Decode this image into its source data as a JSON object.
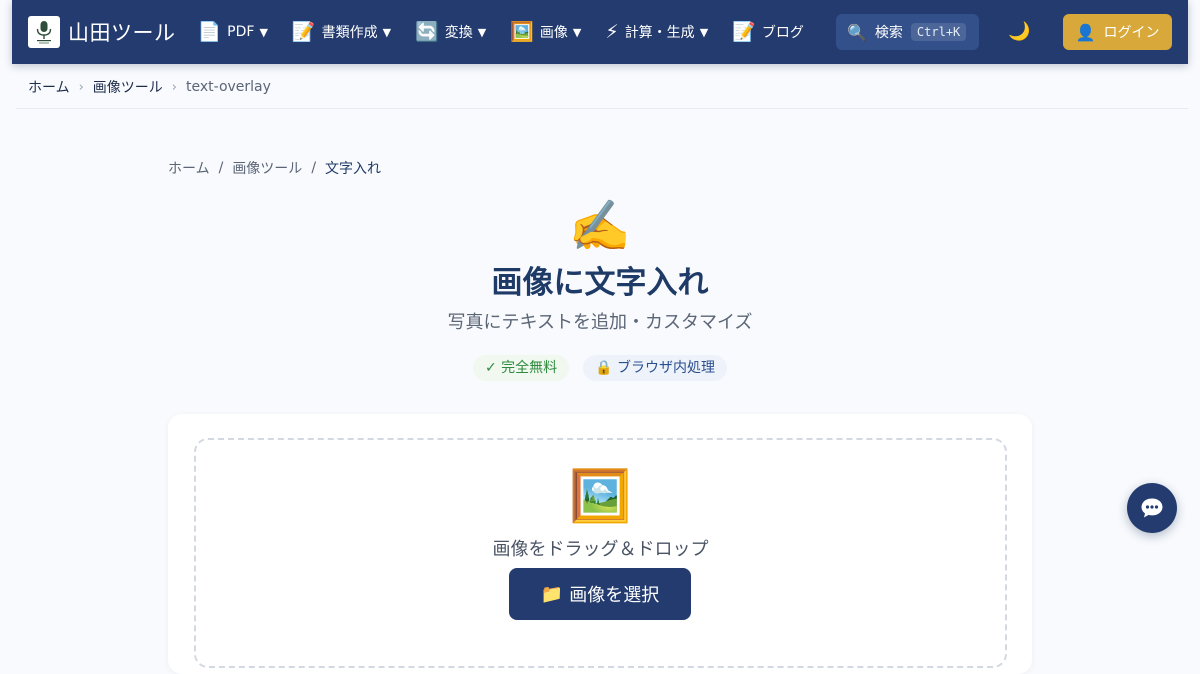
{
  "header": {
    "site_name": "山田ツール",
    "nav": [
      {
        "icon": "📄",
        "label": "PDF",
        "caret": "▼"
      },
      {
        "icon": "📝",
        "label": "書類作成",
        "caret": "▼"
      },
      {
        "icon": "🔄",
        "label": "変換",
        "caret": "▼"
      },
      {
        "icon": "🖼️",
        "label": "画像",
        "caret": "▼"
      },
      {
        "icon": "⚡",
        "label": "計算・生成",
        "caret": "▼"
      },
      {
        "icon": "📝",
        "label": "ブログ",
        "caret": ""
      }
    ],
    "search": {
      "icon": "🔍",
      "label": "検索",
      "shortcut": "Ctrl+K"
    },
    "theme_icon": "🌙",
    "login": {
      "icon": "👤",
      "label": "ログイン"
    }
  },
  "breadcrumb_top": {
    "home": "ホーム",
    "section": "画像ツール",
    "current": "text-overlay",
    "separator": "›"
  },
  "breadcrumb_main": {
    "home": "ホーム",
    "section": "画像ツール",
    "current": "文字入れ",
    "separator": "/"
  },
  "hero": {
    "icon": "✍️",
    "title": "画像に文字入れ",
    "subtitle": "写真にテキストを追加・カスタマイズ",
    "badges": [
      "✓ 完全無料",
      "🔒 ブラウザ内処理"
    ]
  },
  "upload": {
    "icon": "🖼️",
    "prompt": "画像をドラッグ＆ドロップ",
    "button_icon": "📁",
    "button_label": "画像を選択"
  },
  "colors": {
    "header_bg": "#233b6e",
    "accent_gold": "#d8a93a",
    "title_color": "#1e3a66",
    "badge_green": "#2e8b3e",
    "badge_blue": "#2a4f8f"
  },
  "icons": {
    "logo": "microphone-logo-icon",
    "chat": "chat-bubble-icon"
  }
}
